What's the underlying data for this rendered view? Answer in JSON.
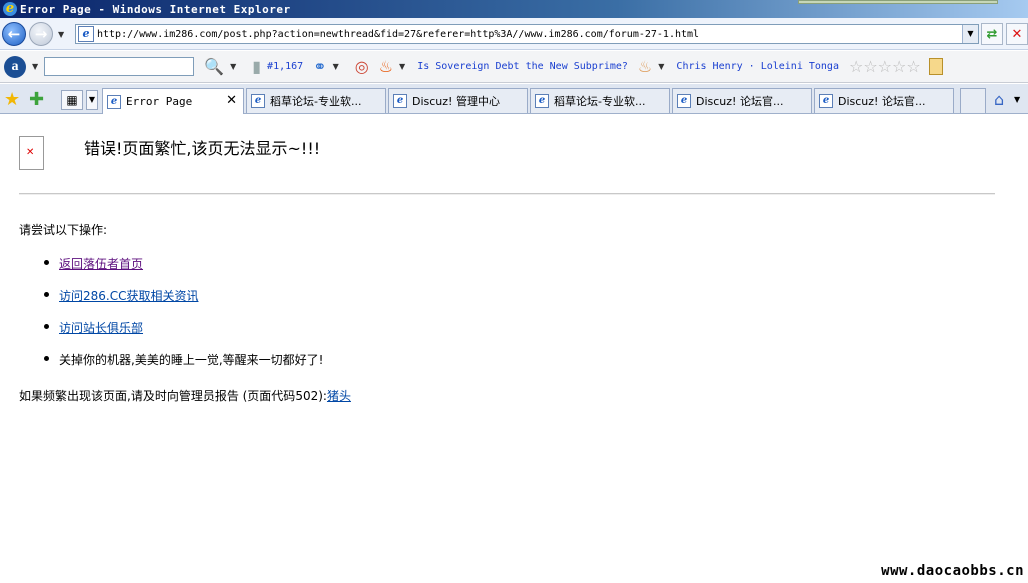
{
  "window": {
    "title": "Error Page - Windows Internet Explorer"
  },
  "address": {
    "url": "http://www.im286.com/post.php?action=newthread&fid=27&referer=http%3A//www.im286.com/forum-27-1.html"
  },
  "toolbar": {
    "count": "#1,167",
    "headline": "Is Sovereign Debt the New Subprime?",
    "person": "Chris Henry · Loleini Tonga",
    "rating_stars": 5
  },
  "tabs": [
    {
      "label": "Error Page",
      "active": true,
      "mono": true
    },
    {
      "label": "稻草论坛-专业软...",
      "active": false
    },
    {
      "label": "Discuz! 管理中心",
      "active": false
    },
    {
      "label": "稻草论坛-专业软...",
      "active": false
    },
    {
      "label": "Discuz! 论坛官...",
      "active": false
    },
    {
      "label": "Discuz! 论坛官...",
      "active": false
    }
  ],
  "content": {
    "title": "错误!页面繁忙,该页无法显示~!!!",
    "try_label": "请尝试以下操作:",
    "links": [
      "返回落伍者首页",
      "访问286.CC获取相关资讯",
      "访问站长俱乐部"
    ],
    "last_item": "关掉你的机器,美美的睡上一觉,等醒来一切都好了!",
    "report_text": "如果频繁出现该页面,请及时向管理员报告 (页面代码502):",
    "report_link": "猪头"
  },
  "watermark": "www.daocaobbs.cn"
}
